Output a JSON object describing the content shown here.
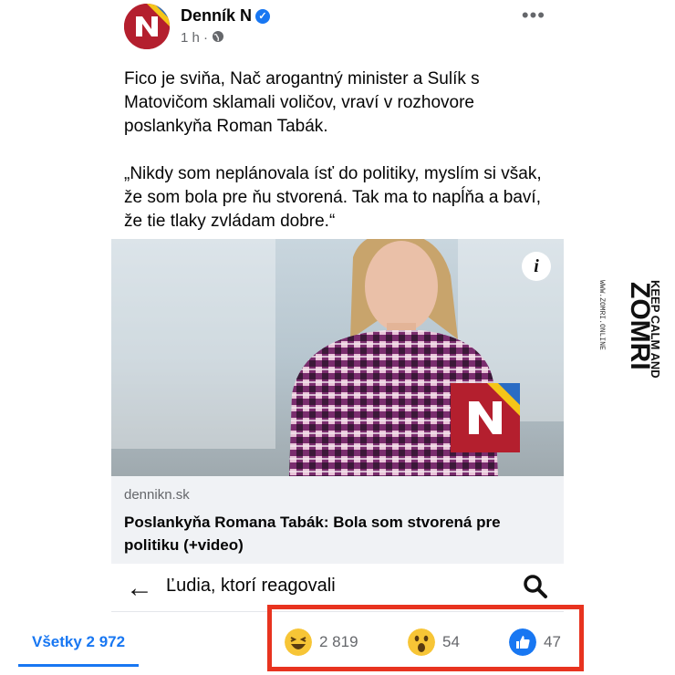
{
  "post": {
    "page_name": "Denník N",
    "time": "1 h · ",
    "text_1": "Fico je sviňa, Nač arogantný minister a Sulík s Matovičom sklamali voličov, vraví v rozhovore poslankyňa Roman Tabák.",
    "text_2": "„Nikdy som neplánovala ísť do politiky, myslím si však, že som bola pre ňu stvorená. Tak ma to napĺňa a baví, že tie tlaky zvládam dobre.“"
  },
  "link": {
    "domain": "dennikn.sk",
    "title": "Poslankyňa Romana Tabák: Bola som stvorená pre politiku (+video)"
  },
  "reactions_header": {
    "label": "Ľudia, ktorí reagovali"
  },
  "reaction_tabs": {
    "all": "Všetky 2 972",
    "haha": "2 819",
    "wow": "54",
    "like": "47"
  },
  "watermark": {
    "line1": "KEEP CALM AND",
    "line2": "ZOMRI",
    "url": "WWW.ZOMRI.ONLINE"
  },
  "colors": {
    "accent": "#1877f2",
    "highlight_box": "#e8331f",
    "brand_red": "#b41f2e"
  }
}
